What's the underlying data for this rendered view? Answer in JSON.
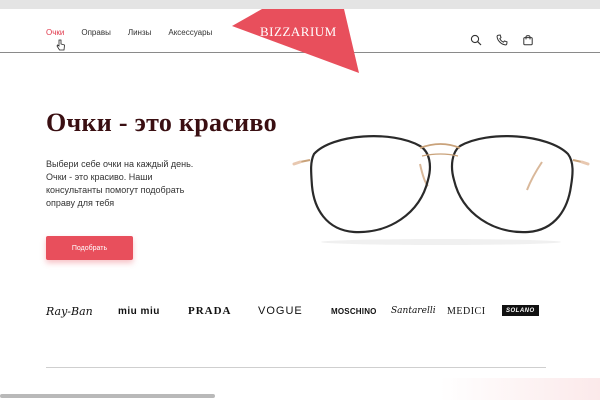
{
  "nav": {
    "items": [
      {
        "label": "Очки",
        "active": true
      },
      {
        "label": "Оправы",
        "active": false
      },
      {
        "label": "Линзы",
        "active": false
      },
      {
        "label": "Аксессуары",
        "active": false
      }
    ]
  },
  "logo": {
    "text": "BIZZARIUM",
    "color": "#e84f5c"
  },
  "header_icons": [
    "search-icon",
    "phone-icon",
    "cart-icon"
  ],
  "hero": {
    "title": "Очки - это красиво",
    "text": "Выбери себе очки на каждый день. Очки - это красиво. Наши консультанты помогут подобрать оправу для тебя",
    "button_label": "Подобрать"
  },
  "brands": [
    "Ray-Ban",
    "miu miu",
    "PRADA",
    "VOGUE",
    "MOSCHINO",
    "Santarelli",
    "MEDICI",
    "SOLANO"
  ],
  "colors": {
    "accent": "#e84f5c",
    "title": "#3a0f12",
    "active_nav": "#e0384b"
  }
}
